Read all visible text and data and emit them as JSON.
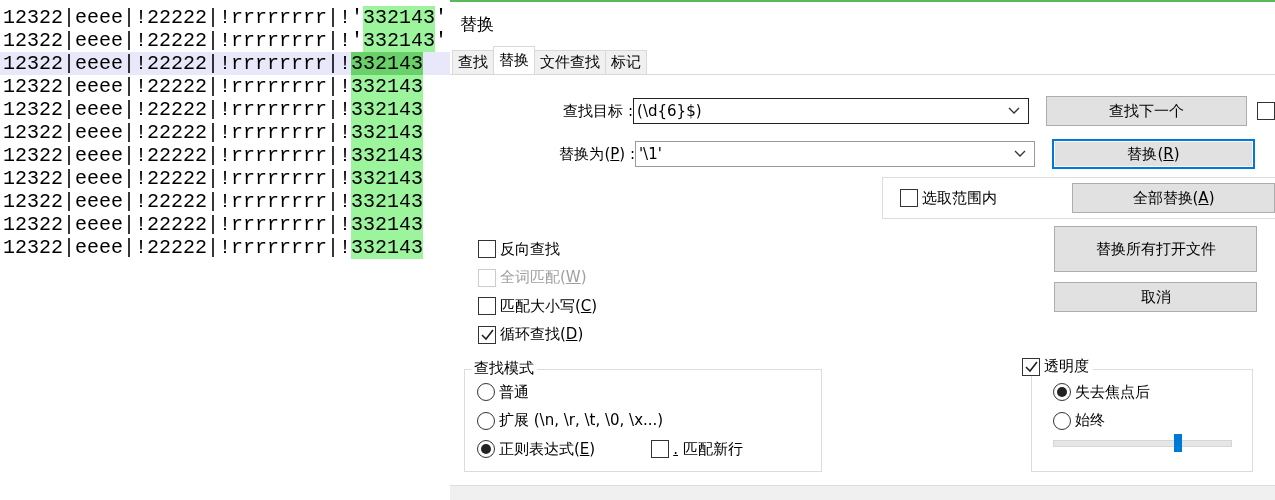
{
  "editor": {
    "lines": [
      {
        "prefix": "12322|eeee|!22222|!rrrrrrrr|!'",
        "match": "332143",
        "suffix": "'",
        "current": false
      },
      {
        "prefix": "12322|eeee|!22222|!rrrrrrrr|!'",
        "match": "332143",
        "suffix": "'",
        "current": false
      },
      {
        "prefix": "12322|eeee|!22222|!rrrrrrrr|!",
        "match": "332143",
        "current": true
      },
      {
        "prefix": "12322|eeee|!22222|!rrrrrrrr|!",
        "match": "332143",
        "current": false
      },
      {
        "prefix": "12322|eeee|!22222|!rrrrrrrr|!",
        "match": "332143",
        "current": false
      },
      {
        "prefix": "12322|eeee|!22222|!rrrrrrrr|!",
        "match": "332143",
        "current": false
      },
      {
        "prefix": "12322|eeee|!22222|!rrrrrrrr|!",
        "match": "332143",
        "current": false
      },
      {
        "prefix": "12322|eeee|!22222|!rrrrrrrr|!",
        "match": "332143",
        "current": false
      },
      {
        "prefix": "12322|eeee|!22222|!rrrrrrrr|!",
        "match": "332143",
        "current": false
      },
      {
        "prefix": "12322|eeee|!22222|!rrrrrrrr|!",
        "match": "332143",
        "current": false
      },
      {
        "prefix": "12322|eeee|!22222|!rrrrrrrr|!",
        "match": "332143",
        "current": false
      }
    ]
  },
  "dialog": {
    "title": "替换",
    "tabs": [
      {
        "label": "查找",
        "selected": false
      },
      {
        "label": "替换",
        "selected": true
      },
      {
        "label": "文件查找",
        "selected": false
      },
      {
        "label": "标记",
        "selected": false
      }
    ],
    "find_field": {
      "label": "查找目标 :",
      "value": "(\\d{6}$)"
    },
    "replace_field": {
      "label": "替换为(",
      "hotkey": "P",
      "label_end": ") :",
      "value": "'\\1'"
    },
    "find_next_button": {
      "label": "查找下一个"
    },
    "side_checkbox": {
      "checked": false
    },
    "replace_button": {
      "label": "替换(",
      "hotkey": "R",
      "label_end": ")",
      "focused": true
    },
    "in_selection": {
      "label": "选取范围内",
      "checked": false
    },
    "replace_all_button": {
      "label": "全部替换(",
      "hotkey": "A",
      "label_end": ")"
    },
    "options": [
      {
        "label": "反向查找",
        "checked": false,
        "disabled": false
      },
      {
        "label": "全词匹配(",
        "hotkey": "W",
        "label_end": ")",
        "checked": false,
        "disabled": true
      },
      {
        "label": "匹配大小写(",
        "hotkey": "C",
        "label_end": ")",
        "checked": false,
        "disabled": false
      },
      {
        "label": "循环查找(",
        "hotkey": "D",
        "label_end": ")",
        "checked": true,
        "disabled": false
      }
    ],
    "replace_all_open_button": {
      "label": "替换所有打开文件"
    },
    "cancel_button": {
      "label": "取消"
    },
    "search_mode": {
      "title": "查找模式",
      "modes": [
        {
          "label": "普通",
          "selected": false
        },
        {
          "label": "扩展 (\\n, \\r, \\t, \\0, \\x...)",
          "selected": false
        },
        {
          "label": "正则表达式(",
          "hotkey": "E",
          "label_end": ")",
          "selected": true
        }
      ],
      "dot_newline": {
        "hotkey": ".",
        "label_end": " 匹配新行",
        "checked": false
      }
    },
    "transparency": {
      "label": "透明度",
      "checked": true,
      "modes": [
        {
          "label": "失去焦点后",
          "selected": true
        },
        {
          "label": "始终",
          "selected": false
        }
      ],
      "level": 0.7
    }
  }
}
